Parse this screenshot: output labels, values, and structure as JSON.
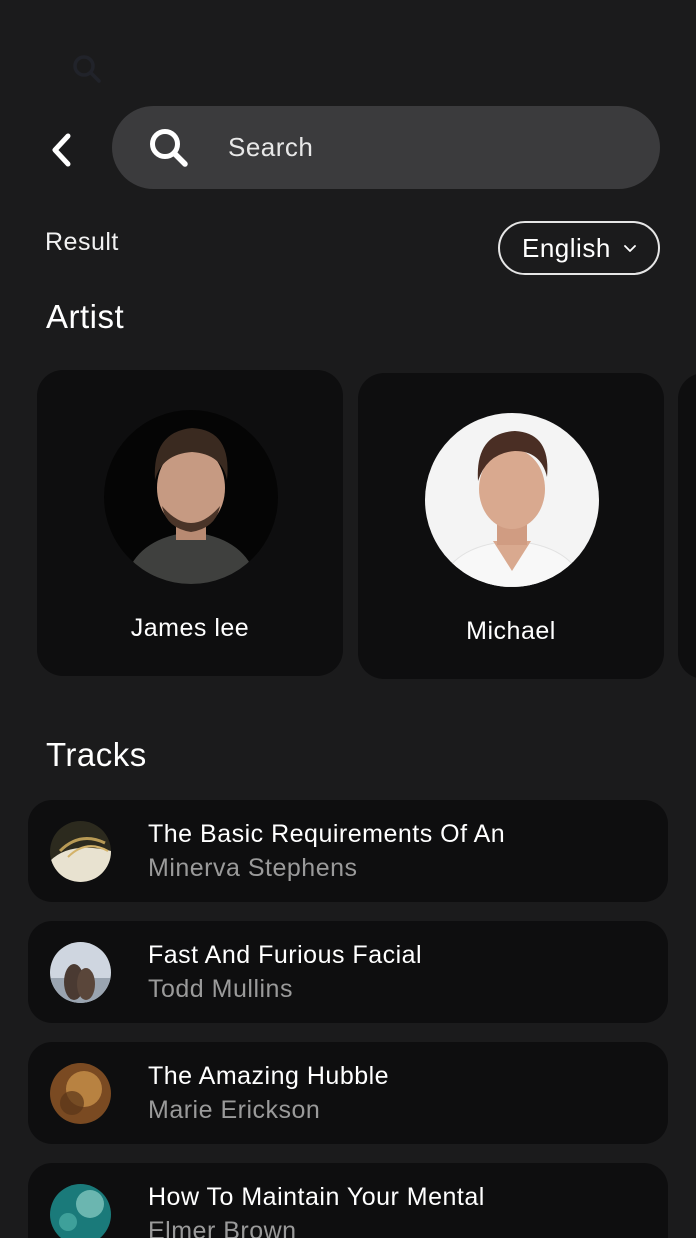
{
  "search": {
    "placeholder": "Search"
  },
  "filter": {
    "result_label": "Result",
    "language_selected": "English"
  },
  "sections": {
    "artist_title": "Artist",
    "tracks_title": "Tracks"
  },
  "artists": [
    {
      "name": "James lee",
      "avatar_bg": "#050505",
      "skin": "#c69a82",
      "hair": "#3a2a20",
      "shirt": "#3f403e"
    },
    {
      "name": "Michael",
      "avatar_bg": "#f4f4f4",
      "skin": "#d9a98f",
      "hair": "#4a2e24",
      "shirt": "#f6f6f6"
    }
  ],
  "tracks": [
    {
      "title": "The Basic Requirements Of An",
      "artist": "Minerva Stephens",
      "thumb_colors": [
        "#2c2a1e",
        "#b89a55"
      ]
    },
    {
      "title": "Fast And Furious Facial",
      "artist": "Todd Mullins",
      "thumb_colors": [
        "#cfd6e0",
        "#4a3a32"
      ]
    },
    {
      "title": "The Amazing Hubble",
      "artist": "Marie Erickson",
      "thumb_colors": [
        "#7a4a22",
        "#c8904a"
      ]
    },
    {
      "title": "How To Maintain Your Mental",
      "artist": "Elmer Brown",
      "thumb_colors": [
        "#1a7a7a",
        "#8fd0c8"
      ]
    }
  ],
  "colors": {
    "background": "#1b1b1c",
    "card": "#0e0e0f",
    "search_bar": "#3b3b3d",
    "secondary_text": "#9a9a9a"
  },
  "icons": {
    "back": "chevron-left-icon",
    "search": "search-icon",
    "dropdown": "chevron-down-icon"
  }
}
